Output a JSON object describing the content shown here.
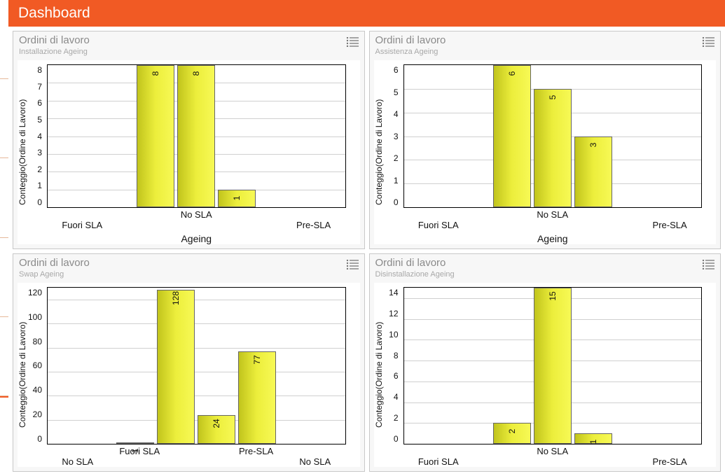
{
  "header": {
    "title": "Dashboard"
  },
  "cards": [
    {
      "title": "Ordini di lavoro",
      "subtitle": "Installazione Ageing",
      "ylabel": "Conteggio(Ordine di Lavoro)",
      "xlabel": "Ageing",
      "x_row1": [
        "No SLA"
      ],
      "x_row2": [
        "Fuori SLA",
        "Pre-SLA"
      ]
    },
    {
      "title": "Ordini di lavoro",
      "subtitle": "Assistenza Ageing",
      "ylabel": "Conteggio(Ordine di Lavoro)",
      "xlabel": "Ageing",
      "x_row1": [
        "No SLA"
      ],
      "x_row2": [
        "Fuori SLA",
        "Pre-SLA"
      ]
    },
    {
      "title": "Ordini di lavoro",
      "subtitle": "Swap Ageing",
      "ylabel": "Conteggio(Ordine di Lavoro)",
      "xlabel": "",
      "x_row1": [
        "Fuori SLA",
        "Pre-SLA"
      ],
      "x_row2": [
        "No SLA",
        "No SLA"
      ]
    },
    {
      "title": "Ordini di lavoro",
      "subtitle": "Disinstallazione Ageing",
      "ylabel": "Conteggio(Ordine di Lavoro)",
      "xlabel": "",
      "x_row1": [
        "No SLA"
      ],
      "x_row2": [
        "Fuori SLA",
        "Pre-SLA"
      ]
    }
  ],
  "chart_data": [
    {
      "type": "bar",
      "title": "Ordini di lavoro — Installazione Ageing",
      "ylabel": "Conteggio(Ordine di Lavoro)",
      "xlabel": "Ageing",
      "categories": [
        "Fuori SLA",
        "No SLA",
        "Pre-SLA"
      ],
      "values": [
        8,
        8,
        1
      ],
      "ylim": [
        0,
        8
      ],
      "yticks": [
        0,
        1,
        2,
        3,
        4,
        5,
        6,
        7,
        8
      ]
    },
    {
      "type": "bar",
      "title": "Ordini di lavoro — Assistenza Ageing",
      "ylabel": "Conteggio(Ordine di Lavoro)",
      "xlabel": "Ageing",
      "categories": [
        "Fuori SLA",
        "No SLA",
        "Pre-SLA"
      ],
      "values": [
        6,
        5,
        3
      ],
      "ylim": [
        0,
        6
      ],
      "yticks": [
        0,
        1,
        2,
        3,
        4,
        5,
        6
      ]
    },
    {
      "type": "bar",
      "title": "Ordini di lavoro — Swap Ageing",
      "ylabel": "Conteggio(Ordine di Lavoro)",
      "xlabel": "",
      "categories": [
        "No SLA",
        "Fuori SLA",
        "No SLA",
        "Pre-SLA"
      ],
      "values": [
        1,
        128,
        24,
        77
      ],
      "ylim": [
        0,
        130
      ],
      "yticks": [
        0,
        20,
        40,
        60,
        80,
        100,
        120
      ]
    },
    {
      "type": "bar",
      "title": "Ordini di lavoro — Disinstallazione Ageing",
      "ylabel": "Conteggio(Ordine di Lavoro)",
      "xlabel": "",
      "categories": [
        "Fuori SLA",
        "No SLA",
        "Pre-SLA"
      ],
      "values": [
        2,
        15,
        1
      ],
      "ylim": [
        0,
        15
      ],
      "yticks": [
        0,
        2,
        4,
        6,
        8,
        10,
        12,
        14
      ]
    }
  ]
}
